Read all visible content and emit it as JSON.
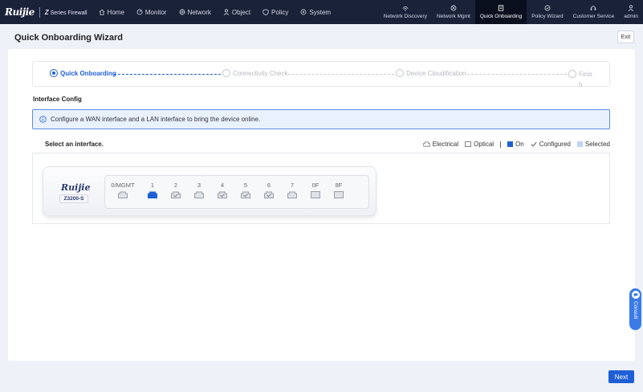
{
  "brand": {
    "logo": "Ruijie",
    "product_prefix": "Z",
    "product_name": "Series Firewall"
  },
  "nav": {
    "main": [
      {
        "label": "Home",
        "icon": "home-icon"
      },
      {
        "label": "Monitor",
        "icon": "monitor-icon"
      },
      {
        "label": "Network",
        "icon": "network-icon"
      },
      {
        "label": "Object",
        "icon": "object-icon"
      },
      {
        "label": "Policy",
        "icon": "policy-icon"
      },
      {
        "label": "System",
        "icon": "system-icon"
      }
    ],
    "right": [
      {
        "label": "Network Discovery",
        "icon": "network-discovery-icon"
      },
      {
        "label": "Network Mgmt",
        "icon": "network-mgmt-icon"
      },
      {
        "label": "Quick Onboarding",
        "icon": "quick-onboarding-icon",
        "active": true
      },
      {
        "label": "Policy Wizard",
        "icon": "policy-wizard-icon"
      },
      {
        "label": "Customer Service",
        "icon": "headset-icon"
      },
      {
        "label": "admin",
        "icon": "user-icon"
      }
    ]
  },
  "page": {
    "title": "Quick Onboarding Wizard",
    "exit_label": "Exit"
  },
  "steps": [
    {
      "label": "Quick Onboarding",
      "state": "active"
    },
    {
      "label": "Connectivity Check",
      "state": "pending"
    },
    {
      "label": "Device Cloudification",
      "state": "pending"
    },
    {
      "label": "Finish",
      "state": "pending",
      "display_line1": "Finis",
      "display_line2": "h"
    }
  ],
  "interface_config": {
    "title": "Interface Config",
    "info": "Configure a WAN interface and a LAN interface to bring the device online.",
    "select_label": "Select an interface.",
    "legend": {
      "electrical": "Electrical",
      "optical": "Optical",
      "on": "On",
      "configured": "Configured",
      "selected": "Selected"
    },
    "colors": {
      "on": "#1f5fd6",
      "selected": "#bfd4f5",
      "accent": "#1f5fd6"
    }
  },
  "device": {
    "logo": "Ruijie",
    "model": "Z3200-S",
    "ports": [
      {
        "label": "0/MGMT",
        "type": "electrical",
        "state": "off"
      },
      {
        "label": "1",
        "type": "electrical",
        "state": "on"
      },
      {
        "label": "2",
        "type": "electrical",
        "state": "configured"
      },
      {
        "label": "3",
        "type": "electrical",
        "state": "off"
      },
      {
        "label": "4",
        "type": "electrical",
        "state": "configured"
      },
      {
        "label": "5",
        "type": "electrical",
        "state": "configured"
      },
      {
        "label": "6",
        "type": "electrical",
        "state": "configured"
      },
      {
        "label": "7",
        "type": "electrical",
        "state": "off"
      },
      {
        "label": "0F",
        "type": "optical",
        "state": "off"
      },
      {
        "label": "8F",
        "type": "optical",
        "state": "off"
      }
    ]
  },
  "footer": {
    "next_label": "Next"
  },
  "consult": {
    "label": "Consult"
  }
}
